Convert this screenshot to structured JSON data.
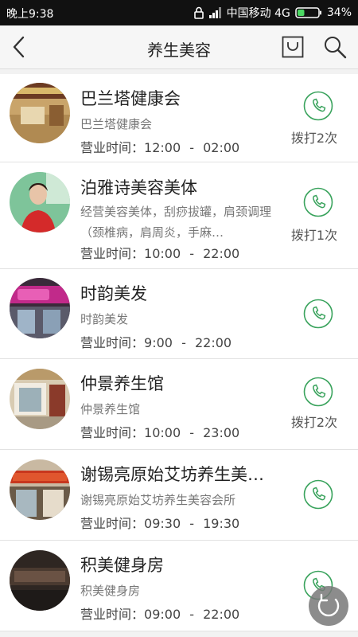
{
  "status_bar": {
    "time": "晚上9:38",
    "carrier": "中国移动 4G",
    "battery": "34%",
    "battery_level": 0.34,
    "battery_color": "#4cd964"
  },
  "nav": {
    "title": "养生美容",
    "back_icon": "chevron-left-icon",
    "bag_icon": "bag-icon",
    "search_icon": "search-icon"
  },
  "accent_color": "#3aa35d",
  "shops": [
    {
      "name": "巴兰塔健康会",
      "desc": "巴兰塔健康会",
      "hours_label": "营业时间：",
      "open": "12:00",
      "dash": "-",
      "close": "02:00",
      "call_count": "拨打2次"
    },
    {
      "name": "泊雅诗美容美体",
      "desc": "经营美容美体，刮痧拔罐，肩颈调理（颈椎病，肩周炎，手麻…",
      "hours_label": "营业时间：",
      "open": "10:00",
      "dash": "-",
      "close": "22:00",
      "call_count": "拨打1次"
    },
    {
      "name": "时韵美发",
      "desc": "时韵美发",
      "hours_label": "营业时间：",
      "open": "9:00",
      "dash": "-",
      "close": "22:00",
      "call_count": ""
    },
    {
      "name": "仲景养生馆",
      "desc": "仲景养生馆",
      "hours_label": "营业时间：",
      "open": "10:00",
      "dash": "-",
      "close": "23:00",
      "call_count": "拨打2次"
    },
    {
      "name": "谢锡亮原始艾坊养生美…",
      "desc": "谢锡亮原始艾坊养生美容会所",
      "hours_label": "营业时间：",
      "open": "09:30",
      "dash": "-",
      "close": "19:30",
      "call_count": ""
    },
    {
      "name": "积美健身房",
      "desc": "积美健身房",
      "hours_label": "营业时间：",
      "open": "09:00",
      "dash": "-",
      "close": "22:00",
      "call_count": ""
    }
  ]
}
